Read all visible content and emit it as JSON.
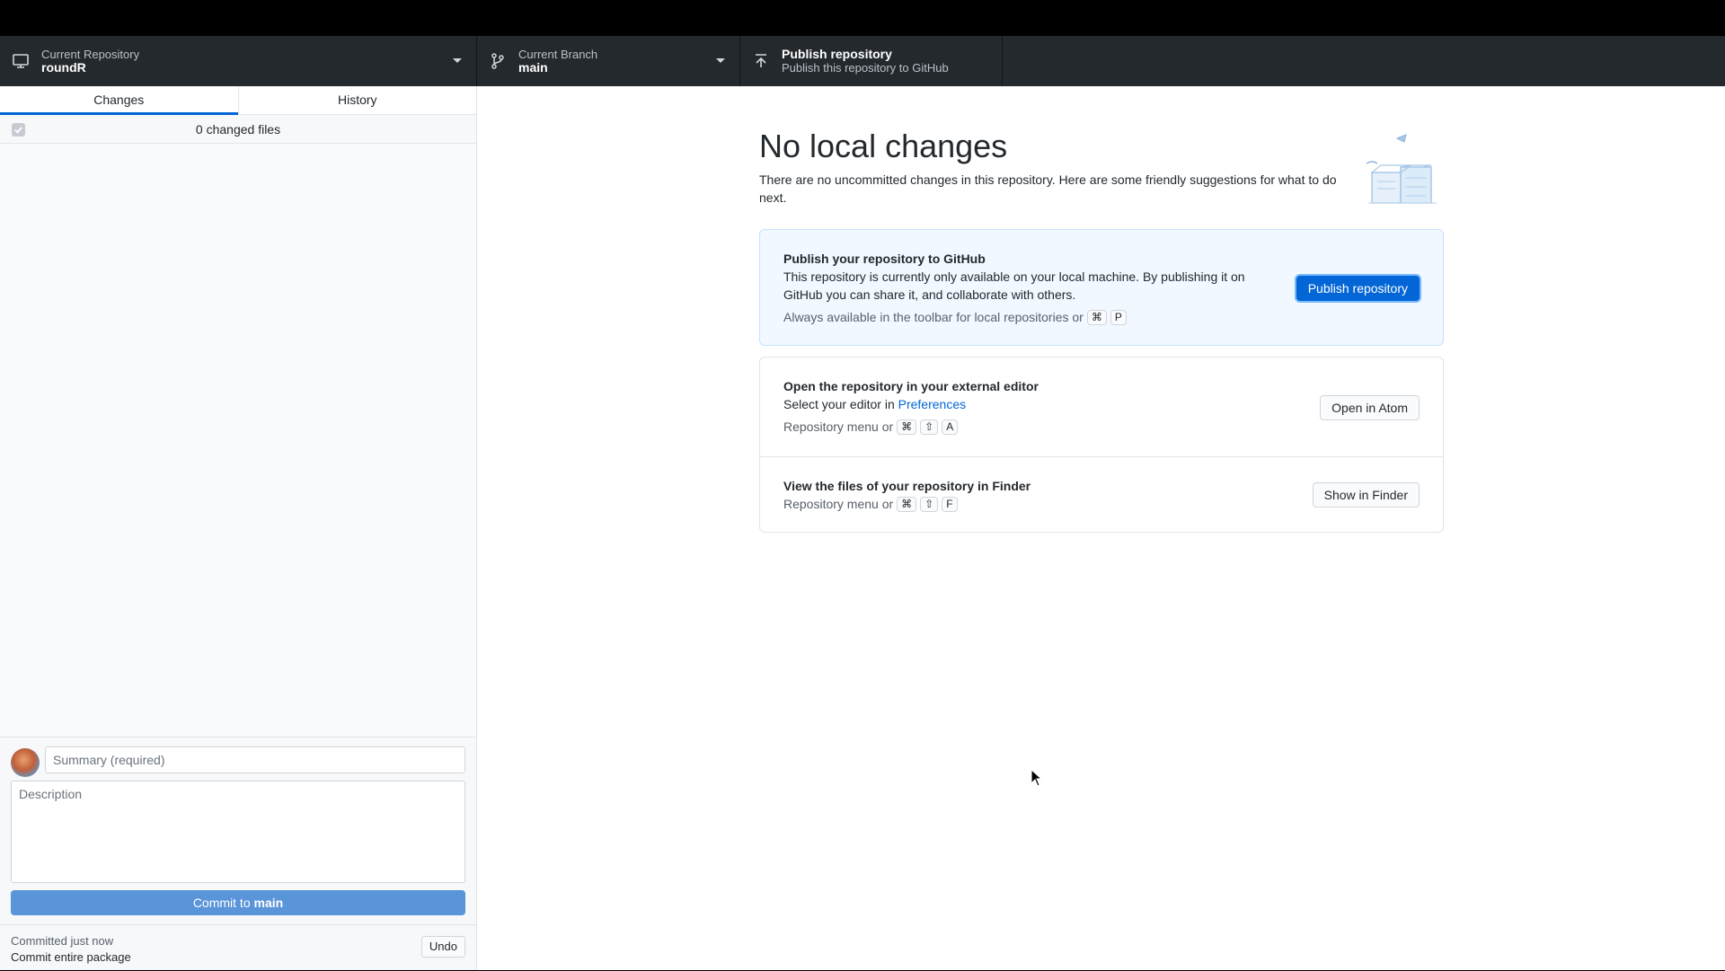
{
  "toolbar": {
    "repo_label": "Current Repository",
    "repo_value": "roundR",
    "branch_label": "Current Branch",
    "branch_value": "main",
    "publish_title": "Publish repository",
    "publish_desc": "Publish this repository to GitHub"
  },
  "sidebar": {
    "tabs": [
      {
        "label": "Changes",
        "active": true
      },
      {
        "label": "History",
        "active": false
      }
    ],
    "changed_files": "0 changed files",
    "summary_placeholder": "Summary (required)",
    "description_placeholder": "Description",
    "commit_prefix": "Commit to",
    "commit_branch": "main",
    "undo_line1": "Committed just now",
    "undo_line2": "Commit entire package",
    "undo_label": "Undo"
  },
  "main": {
    "title": "No local changes",
    "subtitle": "There are no uncommitted changes in this repository. Here are some friendly suggestions for what to do next.",
    "publish_card": {
      "title": "Publish your repository to GitHub",
      "desc": "This repository is currently only available on your local machine. By publishing it on GitHub you can share it, and collaborate with others.",
      "hint": "Always available in the toolbar for local repositories or",
      "keys": [
        "⌘",
        "P"
      ],
      "button": "Publish repository"
    },
    "editor_card": {
      "title": "Open the repository in your external editor",
      "desc_prefix": "Select your editor in",
      "desc_link": "Preferences",
      "hint": "Repository menu or",
      "keys": [
        "⌘",
        "⇧",
        "A"
      ],
      "button": "Open in Atom"
    },
    "finder_card": {
      "title": "View the files of your repository in Finder",
      "hint": "Repository menu or",
      "keys": [
        "⌘",
        "⇧",
        "F"
      ],
      "button": "Show in Finder"
    }
  },
  "colors": {
    "accent": "#0366d6",
    "toolbar_bg": "#24292e",
    "commit_button": "#5a94d9"
  },
  "icons": [
    "desktop-icon",
    "git-branch-icon",
    "upload-icon",
    "checkmark-icon",
    "mouse-cursor-icon"
  ]
}
